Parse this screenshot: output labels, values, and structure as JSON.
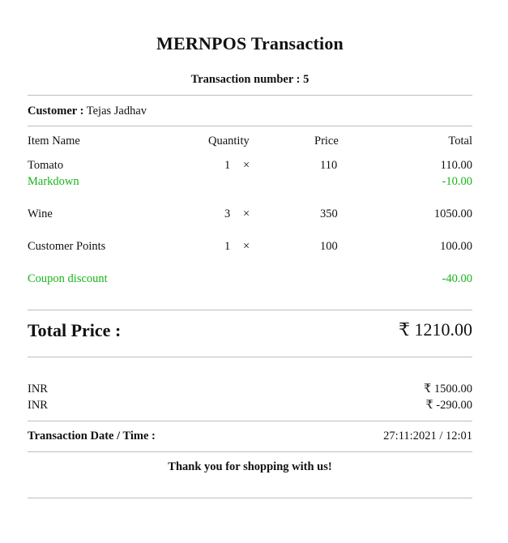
{
  "title": "MERNPOS Transaction",
  "transaction_number": "Transaction number : 5",
  "customer": {
    "label": "Customer :",
    "name": "Tejas Jadhav"
  },
  "columns": {
    "name": "Item Name",
    "quantity": "Quantity",
    "price": "Price",
    "total": "Total"
  },
  "items": [
    {
      "name": "Tomato",
      "qty": "1",
      "x": "×",
      "price": "110",
      "total": "110.00"
    },
    {
      "name": "Wine",
      "qty": "3",
      "x": "×",
      "price": "350",
      "total": "1050.00"
    },
    {
      "name": "Customer Points",
      "qty": "1",
      "x": "×",
      "price": "100",
      "total": "100.00"
    }
  ],
  "markdown": {
    "label": "Markdown",
    "value": "-10.00"
  },
  "coupon": {
    "label": "Coupon discount",
    "value": "-40.00"
  },
  "total": {
    "label": "Total Price :",
    "value": "₹ 1210.00"
  },
  "payments": [
    {
      "currency": "INR",
      "amount": "₹ 1500.00"
    },
    {
      "currency": "INR",
      "amount": "₹ -290.00"
    }
  ],
  "datetime": {
    "label": "Transaction Date / Time :",
    "value": "27:11:2021 / 12:01"
  },
  "thanks": "Thank you for shopping with us!",
  "colors": {
    "discount": "#18b418",
    "rule": "#bdbdbd",
    "text": "#111111"
  }
}
